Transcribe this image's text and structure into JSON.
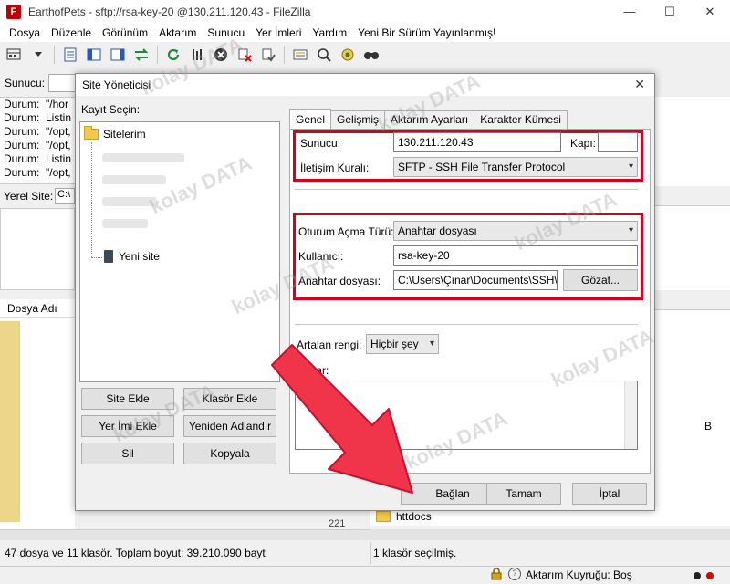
{
  "window": {
    "title": "EarthofPets - sftp://rsa-key-20        @130.211.120.43 - FileZilla",
    "app_icon": "F",
    "controls": [
      "—",
      "☐",
      "✕"
    ]
  },
  "menu": [
    "Dosya",
    "Düzenle",
    "Görünüm",
    "Aktarım",
    "Sunucu",
    "Yer İmleri",
    "Yardım",
    "Yeni Bir Sürüm Yayınlanmış!"
  ],
  "quickconnect": {
    "host_label": "Sunucu:"
  },
  "log": {
    "lines": [
      {
        "status": "Durum:",
        "text": "\"/hor"
      },
      {
        "status": "Durum:",
        "text": "Listin"
      },
      {
        "status": "Durum:",
        "text": "\"/opt,"
      },
      {
        "status": "Durum:",
        "text": "\"/opt,"
      },
      {
        "status": "Durum:",
        "text": "Listin"
      },
      {
        "status": "Durum:",
        "text": "\"/opt,"
      }
    ]
  },
  "local": {
    "site_label": "Yerel Site:",
    "site_value": "C:\\",
    "file_header": "Dosya Adı",
    "file_count": "221",
    "status": "47 dosya ve 11 klasör. Toplam boyut: 39.210.090 bayt"
  },
  "remote": {
    "folder_name": "httdocs",
    "status": "1 klasör seçilmiş.",
    "side_letter": "B"
  },
  "queue": {
    "label": "Aktarım Kuyruğu: Boş"
  },
  "dialog": {
    "title": "Site Yöneticisi",
    "select_label": "Kayıt Seçin:",
    "tree_root": "Sitelerim",
    "tree_new_site": "Yeni site",
    "buttons": {
      "add_site": "Site Ekle",
      "add_folder": "Klasör Ekle",
      "add_bookmark": "Yer İmi Ekle",
      "rename": "Yeniden Adlandır",
      "delete": "Sil",
      "copy": "Kopyala",
      "connect": "Bağlan",
      "ok": "Tamam",
      "cancel": "İptal",
      "browse": "Gözat..."
    },
    "tabs": [
      "Genel",
      "Gelişmiş",
      "Aktarım Ayarları",
      "Karakter Kümesi"
    ],
    "fields": {
      "host_label": "Sunucu:",
      "host_value": "130.211.120.43",
      "port_label": "Kapı:",
      "port_value": "",
      "protocol_label": "İletişim Kuralı:",
      "protocol_value": "SFTP - SSH File Transfer Protocol",
      "logon_type_label": "Oturum Açma Türü:",
      "logon_type_value": "Anahtar dosyası",
      "user_label": "Kullanıcı:",
      "user_value": "rsa-key-20",
      "keyfile_label": "Anahtar dosyası:",
      "keyfile_value": "C:\\Users\\Çınar\\Documents\\SSH\\s",
      "bg_color_label": "Artalan rengi:",
      "bg_color_value": "Hiçbir şey",
      "notes_label": "Notlar:"
    }
  },
  "watermark": "kolay DATA",
  "colors": {
    "highlight_red": "#d6001c",
    "arrow_red": "#f0344a",
    "folder_yellow": "#f2c94c"
  }
}
